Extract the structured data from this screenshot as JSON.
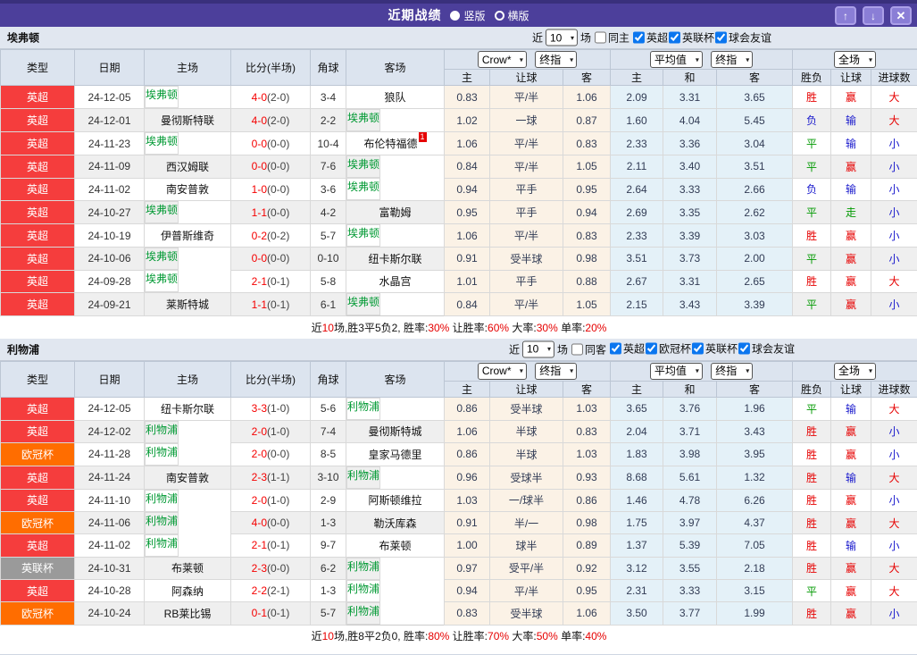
{
  "topbar": {
    "title": "近期战绩",
    "radios": [
      {
        "label": "竖版",
        "selected": true
      },
      {
        "label": "横版",
        "selected": false
      }
    ],
    "buttons": {
      "up": "↑",
      "down": "↓",
      "close": "✕"
    }
  },
  "table_headers": {
    "left": [
      "类型",
      "日期",
      "主场",
      "比分(半场)",
      "角球",
      "客场"
    ],
    "g1": [
      "Crow*",
      "终指"
    ],
    "g2": [
      "平均值",
      "终指"
    ],
    "g3": [
      "全场"
    ],
    "sub": [
      "主",
      "让球",
      "客",
      "主",
      "和",
      "客",
      "胜负",
      "让球",
      "进球数"
    ]
  },
  "league_colors": {
    "英超": "#f53d3d",
    "欧冠杯": "#ff6d00",
    "英联杯": "#9a9a9a"
  },
  "result_colors": {
    "胜": "red",
    "平": "green",
    "负": "blue",
    "赢": "red",
    "输": "blue",
    "走": "green",
    "大": "red",
    "小": "blue"
  },
  "sections": [
    {
      "team": "埃弗顿",
      "filter": {
        "near": "近",
        "count": "10",
        "games": "场",
        "same": "同主",
        "same_checked": false,
        "leagues": [
          "英超",
          "英联杯",
          "球会友谊"
        ]
      },
      "rows": [
        {
          "lg": "英超",
          "dt": "24-12-05",
          "hm": "埃弗顿",
          "hsel": true,
          "sc": "4-0",
          "hf": "(2-0)",
          "cn": "3-4",
          "aw": "狼队",
          "asel": false,
          "bdg": "",
          "ho": "0.83",
          "ln": "平/半",
          "ao": "1.06",
          "ah": "2.09",
          "ad": "3.31",
          "aa": "3.65",
          "r1": "胜",
          "r2": "赢",
          "r3": "大"
        },
        {
          "lg": "英超",
          "dt": "24-12-01",
          "hm": "曼彻斯特联",
          "hsel": false,
          "sc": "4-0",
          "hf": "(2-0)",
          "cn": "2-2",
          "aw": "埃弗顿",
          "asel": true,
          "bdg": "",
          "ho": "1.02",
          "ln": "一球",
          "ao": "0.87",
          "ah": "1.60",
          "ad": "4.04",
          "aa": "5.45",
          "r1": "负",
          "r2": "输",
          "r3": "大"
        },
        {
          "lg": "英超",
          "dt": "24-11-23",
          "hm": "埃弗顿",
          "hsel": true,
          "sc": "0-0",
          "hf": "(0-0)",
          "cn": "10-4",
          "aw": "布伦特福德",
          "asel": false,
          "bdg": "1",
          "ho": "1.06",
          "ln": "平/半",
          "ao": "0.83",
          "ah": "2.33",
          "ad": "3.36",
          "aa": "3.04",
          "r1": "平",
          "r2": "输",
          "r3": "小"
        },
        {
          "lg": "英超",
          "dt": "24-11-09",
          "hm": "西汉姆联",
          "hsel": false,
          "sc": "0-0",
          "hf": "(0-0)",
          "cn": "7-6",
          "aw": "埃弗顿",
          "asel": true,
          "bdg": "",
          "ho": "0.84",
          "ln": "平/半",
          "ao": "1.05",
          "ah": "2.11",
          "ad": "3.40",
          "aa": "3.51",
          "r1": "平",
          "r2": "赢",
          "r3": "小"
        },
        {
          "lg": "英超",
          "dt": "24-11-02",
          "hm": "南安普敦",
          "hsel": false,
          "sc": "1-0",
          "hf": "(0-0)",
          "cn": "3-6",
          "aw": "埃弗顿",
          "asel": true,
          "bdg": "",
          "ho": "0.94",
          "ln": "平手",
          "ao": "0.95",
          "ah": "2.64",
          "ad": "3.33",
          "aa": "2.66",
          "r1": "负",
          "r2": "输",
          "r3": "小"
        },
        {
          "lg": "英超",
          "dt": "24-10-27",
          "hm": "埃弗顿",
          "hsel": true,
          "sc": "1-1",
          "hf": "(0-0)",
          "cn": "4-2",
          "aw": "富勒姆",
          "asel": false,
          "bdg": "",
          "ho": "0.95",
          "ln": "平手",
          "ao": "0.94",
          "ah": "2.69",
          "ad": "3.35",
          "aa": "2.62",
          "r1": "平",
          "r2": "走",
          "r3": "小"
        },
        {
          "lg": "英超",
          "dt": "24-10-19",
          "hm": "伊普斯维奇",
          "hsel": false,
          "sc": "0-2",
          "hf": "(0-2)",
          "cn": "5-7",
          "aw": "埃弗顿",
          "asel": true,
          "bdg": "",
          "ho": "1.06",
          "ln": "平/半",
          "ao": "0.83",
          "ah": "2.33",
          "ad": "3.39",
          "aa": "3.03",
          "r1": "胜",
          "r2": "赢",
          "r3": "小"
        },
        {
          "lg": "英超",
          "dt": "24-10-06",
          "hm": "埃弗顿",
          "hsel": true,
          "sc": "0-0",
          "hf": "(0-0)",
          "cn": "0-10",
          "aw": "纽卡斯尔联",
          "asel": false,
          "bdg": "",
          "ho": "0.91",
          "ln": "受半球",
          "ao": "0.98",
          "ah": "3.51",
          "ad": "3.73",
          "aa": "2.00",
          "r1": "平",
          "r2": "赢",
          "r3": "小"
        },
        {
          "lg": "英超",
          "dt": "24-09-28",
          "hm": "埃弗顿",
          "hsel": true,
          "sc": "2-1",
          "hf": "(0-1)",
          "cn": "5-8",
          "aw": "水晶宫",
          "asel": false,
          "bdg": "",
          "ho": "1.01",
          "ln": "平手",
          "ao": "0.88",
          "ah": "2.67",
          "ad": "3.31",
          "aa": "2.65",
          "r1": "胜",
          "r2": "赢",
          "r3": "大"
        },
        {
          "lg": "英超",
          "dt": "24-09-21",
          "hm": "莱斯特城",
          "hsel": false,
          "sc": "1-1",
          "hf": "(0-1)",
          "cn": "6-1",
          "aw": "埃弗顿",
          "asel": true,
          "bdg": "",
          "ho": "0.84",
          "ln": "平/半",
          "ao": "1.05",
          "ah": "2.15",
          "ad": "3.43",
          "aa": "3.39",
          "r1": "平",
          "r2": "赢",
          "r3": "小"
        }
      ],
      "summary": [
        [
          "近",
          false
        ],
        [
          "10",
          true
        ],
        [
          "场,胜3平5负2, 胜率:",
          false
        ],
        [
          "30%",
          true
        ],
        [
          " 让胜率:",
          false
        ],
        [
          "60%",
          true
        ],
        [
          " 大率:",
          false
        ],
        [
          "30%",
          true
        ],
        [
          " 单率:",
          false
        ],
        [
          "20%",
          true
        ]
      ]
    },
    {
      "team": "利物浦",
      "filter": {
        "near": "近",
        "count": "10",
        "games": "场",
        "same": "同客",
        "same_checked": false,
        "leagues": [
          "英超",
          "欧冠杯",
          "英联杯",
          "球会友谊"
        ]
      },
      "rows": [
        {
          "lg": "英超",
          "dt": "24-12-05",
          "hm": "纽卡斯尔联",
          "hsel": false,
          "sc": "3-3",
          "hf": "(1-0)",
          "cn": "5-6",
          "aw": "利物浦",
          "asel": true,
          "bdg": "",
          "ho": "0.86",
          "ln": "受半球",
          "ao": "1.03",
          "ah": "3.65",
          "ad": "3.76",
          "aa": "1.96",
          "r1": "平",
          "r2": "输",
          "r3": "大"
        },
        {
          "lg": "英超",
          "dt": "24-12-02",
          "hm": "利物浦",
          "hsel": true,
          "sc": "2-0",
          "hf": "(1-0)",
          "cn": "7-4",
          "aw": "曼彻斯特城",
          "asel": false,
          "bdg": "",
          "ho": "1.06",
          "ln": "半球",
          "ao": "0.83",
          "ah": "2.04",
          "ad": "3.71",
          "aa": "3.43",
          "r1": "胜",
          "r2": "赢",
          "r3": "小"
        },
        {
          "lg": "欧冠杯",
          "dt": "24-11-28",
          "hm": "利物浦",
          "hsel": true,
          "sc": "2-0",
          "hf": "(0-0)",
          "cn": "8-5",
          "aw": "皇家马德里",
          "asel": false,
          "bdg": "",
          "ho": "0.86",
          "ln": "半球",
          "ao": "1.03",
          "ah": "1.83",
          "ad": "3.98",
          "aa": "3.95",
          "r1": "胜",
          "r2": "赢",
          "r3": "小"
        },
        {
          "lg": "英超",
          "dt": "24-11-24",
          "hm": "南安普敦",
          "hsel": false,
          "sc": "2-3",
          "hf": "(1-1)",
          "cn": "3-10",
          "aw": "利物浦",
          "asel": true,
          "bdg": "",
          "ho": "0.96",
          "ln": "受球半",
          "ao": "0.93",
          "ah": "8.68",
          "ad": "5.61",
          "aa": "1.32",
          "r1": "胜",
          "r2": "输",
          "r3": "大"
        },
        {
          "lg": "英超",
          "dt": "24-11-10",
          "hm": "利物浦",
          "hsel": true,
          "sc": "2-0",
          "hf": "(1-0)",
          "cn": "2-9",
          "aw": "阿斯顿维拉",
          "asel": false,
          "bdg": "",
          "ho": "1.03",
          "ln": "一/球半",
          "ao": "0.86",
          "ah": "1.46",
          "ad": "4.78",
          "aa": "6.26",
          "r1": "胜",
          "r2": "赢",
          "r3": "小"
        },
        {
          "lg": "欧冠杯",
          "dt": "24-11-06",
          "hm": "利物浦",
          "hsel": true,
          "sc": "4-0",
          "hf": "(0-0)",
          "cn": "1-3",
          "aw": "勒沃库森",
          "asel": false,
          "bdg": "",
          "ho": "0.91",
          "ln": "半/一",
          "ao": "0.98",
          "ah": "1.75",
          "ad": "3.97",
          "aa": "4.37",
          "r1": "胜",
          "r2": "赢",
          "r3": "大"
        },
        {
          "lg": "英超",
          "dt": "24-11-02",
          "hm": "利物浦",
          "hsel": true,
          "sc": "2-1",
          "hf": "(0-1)",
          "cn": "9-7",
          "aw": "布莱顿",
          "asel": false,
          "bdg": "",
          "ho": "1.00",
          "ln": "球半",
          "ao": "0.89",
          "ah": "1.37",
          "ad": "5.39",
          "aa": "7.05",
          "r1": "胜",
          "r2": "输",
          "r3": "小"
        },
        {
          "lg": "英联杯",
          "dt": "24-10-31",
          "hm": "布莱顿",
          "hsel": false,
          "sc": "2-3",
          "hf": "(0-0)",
          "cn": "6-2",
          "aw": "利物浦",
          "asel": true,
          "bdg": "",
          "ho": "0.97",
          "ln": "受平/半",
          "ao": "0.92",
          "ah": "3.12",
          "ad": "3.55",
          "aa": "2.18",
          "r1": "胜",
          "r2": "赢",
          "r3": "大"
        },
        {
          "lg": "英超",
          "dt": "24-10-28",
          "hm": "阿森纳",
          "hsel": false,
          "sc": "2-2",
          "hf": "(2-1)",
          "cn": "1-3",
          "aw": "利物浦",
          "asel": true,
          "bdg": "",
          "ho": "0.94",
          "ln": "平/半",
          "ao": "0.95",
          "ah": "2.31",
          "ad": "3.33",
          "aa": "3.15",
          "r1": "平",
          "r2": "赢",
          "r3": "大"
        },
        {
          "lg": "欧冠杯",
          "dt": "24-10-24",
          "hm": "RB莱比锡",
          "hsel": false,
          "sc": "0-1",
          "hf": "(0-1)",
          "cn": "5-7",
          "aw": "利物浦",
          "asel": true,
          "bdg": "",
          "ho": "0.83",
          "ln": "受半球",
          "ao": "1.06",
          "ah": "3.50",
          "ad": "3.77",
          "aa": "1.99",
          "r1": "胜",
          "r2": "赢",
          "r3": "小"
        }
      ],
      "summary": [
        [
          "近",
          false
        ],
        [
          "10",
          true
        ],
        [
          "场,胜8平2负0, 胜率:",
          false
        ],
        [
          "80%",
          true
        ],
        [
          " 让胜率:",
          false
        ],
        [
          "70%",
          true
        ],
        [
          " 大率:",
          false
        ],
        [
          "50%",
          true
        ],
        [
          " 单率:",
          false
        ],
        [
          "40%",
          true
        ]
      ]
    }
  ]
}
